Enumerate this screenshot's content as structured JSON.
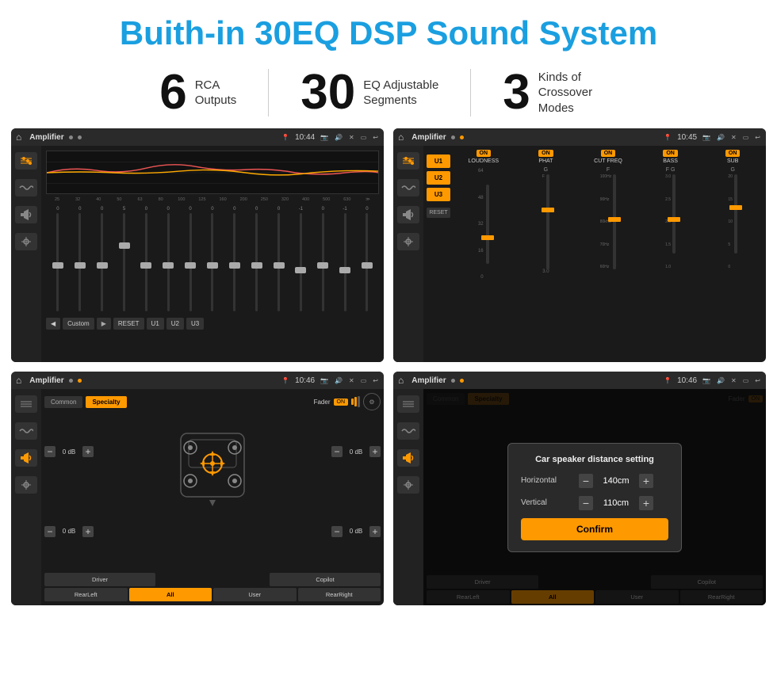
{
  "header": {
    "title": "Buith-in 30EQ DSP Sound System"
  },
  "stats": [
    {
      "number": "6",
      "line1": "RCA",
      "line2": "Outputs"
    },
    {
      "number": "30",
      "line1": "EQ Adjustable",
      "line2": "Segments"
    },
    {
      "number": "3",
      "line1": "Kinds of",
      "line2": "Crossover Modes"
    }
  ],
  "screens": [
    {
      "id": "screen1",
      "topbar": {
        "title": "Amplifier",
        "time": "10:44"
      },
      "type": "eq",
      "freqs": [
        "25",
        "32",
        "40",
        "50",
        "63",
        "80",
        "100",
        "125",
        "160",
        "200",
        "250",
        "320",
        "400",
        "500",
        "630"
      ],
      "values": [
        "0",
        "0",
        "0",
        "5",
        "0",
        "0",
        "0",
        "0",
        "0",
        "0",
        "0",
        "-1",
        "0",
        "-1"
      ],
      "preset": "Custom",
      "buttons": [
        "RESET",
        "U1",
        "U2",
        "U3"
      ]
    },
    {
      "id": "screen2",
      "topbar": {
        "title": "Amplifier",
        "time": "10:45"
      },
      "type": "amplifier",
      "channels": [
        "U1",
        "U2",
        "U3"
      ],
      "controls": [
        {
          "label": "LOUDNESS",
          "on": true
        },
        {
          "label": "PHAT",
          "on": true
        },
        {
          "label": "CUT FREQ",
          "on": true
        },
        {
          "label": "BASS",
          "on": true
        },
        {
          "label": "SUB",
          "on": true
        }
      ]
    },
    {
      "id": "screen3",
      "topbar": {
        "title": "Amplifier",
        "time": "10:46"
      },
      "type": "speaker",
      "tabs": [
        "Common",
        "Specialty"
      ],
      "activeTab": "Specialty",
      "faderLabel": "Fader",
      "faderOn": true,
      "dbValues": [
        "0 dB",
        "0 dB",
        "0 dB",
        "0 dB"
      ],
      "buttons": [
        "Driver",
        "",
        "Copilot",
        "RearLeft",
        "All",
        "User",
        "RearRight"
      ]
    },
    {
      "id": "screen4",
      "topbar": {
        "title": "Amplifier",
        "time": "10:46"
      },
      "type": "speaker-dialog",
      "tabs": [
        "Common",
        "Specialty"
      ],
      "dialog": {
        "title": "Car speaker distance setting",
        "horizontal": {
          "label": "Horizontal",
          "value": "140cm"
        },
        "vertical": {
          "label": "Vertical",
          "value": "110cm"
        },
        "confirm": "Confirm"
      },
      "buttons": [
        "Driver",
        "Copilot",
        "RearLeft",
        "All",
        "User",
        "RearRight"
      ]
    }
  ]
}
